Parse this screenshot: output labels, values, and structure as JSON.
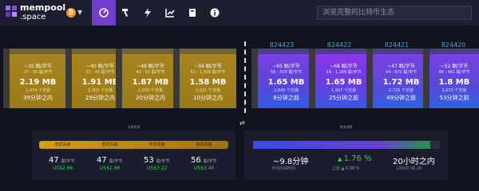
{
  "header": {
    "logo_line1": "mempool",
    "logo_line2": ".space",
    "network_symbol": "₿",
    "search_placeholder": "浏览完整的比特币生态",
    "nav": [
      "dashboard",
      "mining",
      "lightning",
      "graphs",
      "docs",
      "about"
    ]
  },
  "mempool_blocks": [
    {
      "fee": "~35 聪/字节",
      "range": "17 - 35 聪/字节",
      "size": "2.19 MB",
      "tx": "2,474 个交易",
      "eta": "39分钟之内"
    },
    {
      "fee": "~40 聪/字节",
      "range": "37 - 43 聪/字节",
      "size": "1.91 MB",
      "tx": "3,303 个交易",
      "eta": "29分钟之内"
    },
    {
      "fee": "~48 聪/字节",
      "range": "43 - 51 聪/字节",
      "size": "1.87 MB",
      "tx": "2,559 个交易",
      "eta": "20分钟之内"
    },
    {
      "fee": "~56 聪/字节",
      "range": "51 - 1,656 聪/字节",
      "size": "1.58 MB",
      "tx": "2,021 个交易",
      "eta": "10分钟之内"
    }
  ],
  "mined_blocks": [
    {
      "height": "824423",
      "fee": "~65 聪/字节",
      "range": "56 - 500 聪/字节",
      "size": "1.65 MB",
      "tx": "2,645 个交易",
      "eta": "8分钟之前"
    },
    {
      "height": "824422",
      "fee": "~68 聪/字节",
      "range": "58 - 1,269 聪/字节",
      "size": "1.65 MB",
      "tx": "1,907 个交易",
      "eta": "25分钟之前"
    },
    {
      "height": "824421",
      "fee": "~47 聪/字节",
      "range": "44 - 672 聪/字节",
      "size": "1.72 MB",
      "tx": "2,726 个交易",
      "eta": "49分钟之前"
    },
    {
      "height": "824420",
      "fee": "~52 聪/字节",
      "range": "48 - 461 聪/字节",
      "size": "1.8 MB",
      "tx": "2,673 个交易",
      "eta": "53分钟之前"
    }
  ],
  "fees": {
    "title": "交易费用",
    "labels": [
      "无优先级",
      "低优先级",
      "中优先级",
      "高优先级"
    ],
    "values": [
      "47",
      "47",
      "53",
      "56"
    ],
    "unit": "聪/字节",
    "usd": [
      "US$2.86",
      "US$2.86",
      "US$3.22",
      "US$3.40"
    ]
  },
  "difficulty": {
    "title": "难度调整",
    "progress_fraction": 0.95,
    "avg_time": "~9.8分钟",
    "avg_label": "平均出块时间",
    "change": "1.76 %",
    "change_prev_label": "之前",
    "change_prev": "6.98 %",
    "remaining": "20小时之内",
    "date": "1月6日 08:26"
  }
}
